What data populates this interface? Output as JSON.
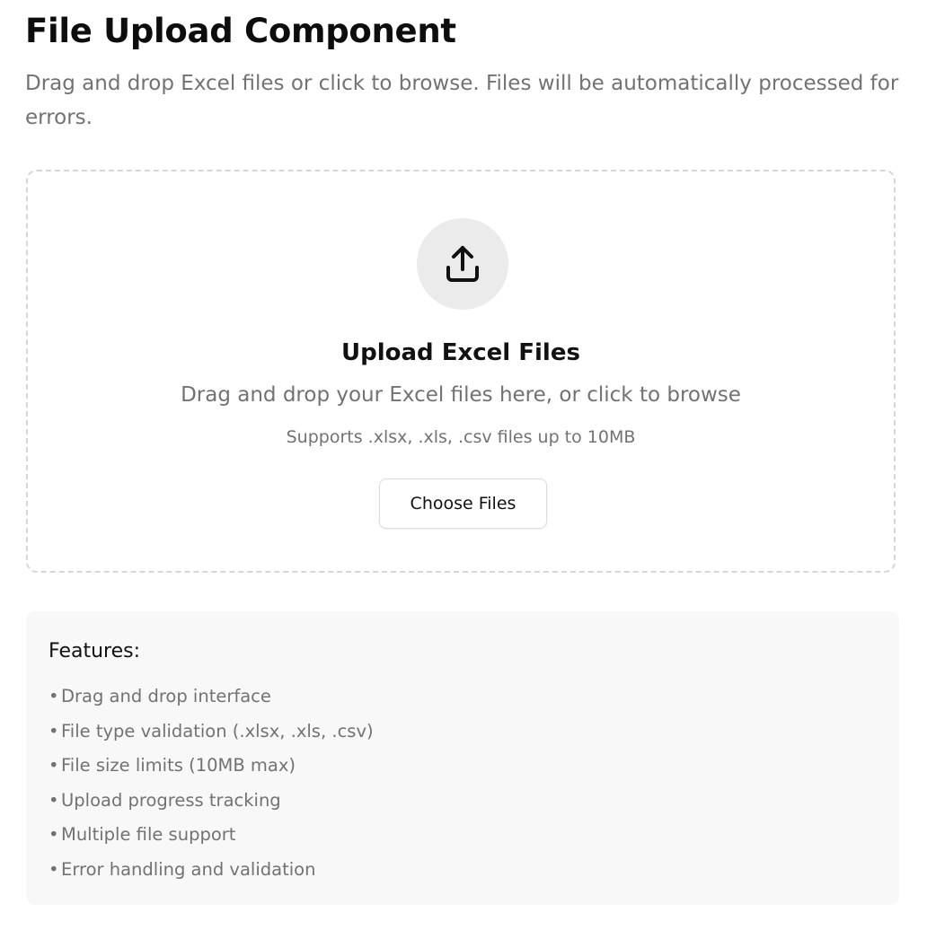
{
  "header": {
    "title": "File Upload Component",
    "description": "Drag and drop Excel files or click to browse. Files will be automatically processed for errors."
  },
  "dropzone": {
    "icon": "upload-icon",
    "title": "Upload Excel Files",
    "description": "Drag and drop your Excel files here, or click to browse",
    "limits": "Supports .xlsx, .xls, .csv files up to 10MB",
    "button_label": "Choose Files"
  },
  "features": {
    "title": "Features:",
    "bullet": "•",
    "items": [
      "Drag and drop interface",
      "File type validation (.xlsx, .xls, .csv)",
      "File size limits (10MB max)",
      "Upload progress tracking",
      "Multiple file support",
      "Error handling and validation"
    ]
  },
  "colors": {
    "title_text": "#0d0d0d",
    "muted_text": "#727272",
    "dropzone_border": "#d6d6d6",
    "icon_circle": "#ebebeb",
    "features_bg": "#f8f8f8"
  }
}
